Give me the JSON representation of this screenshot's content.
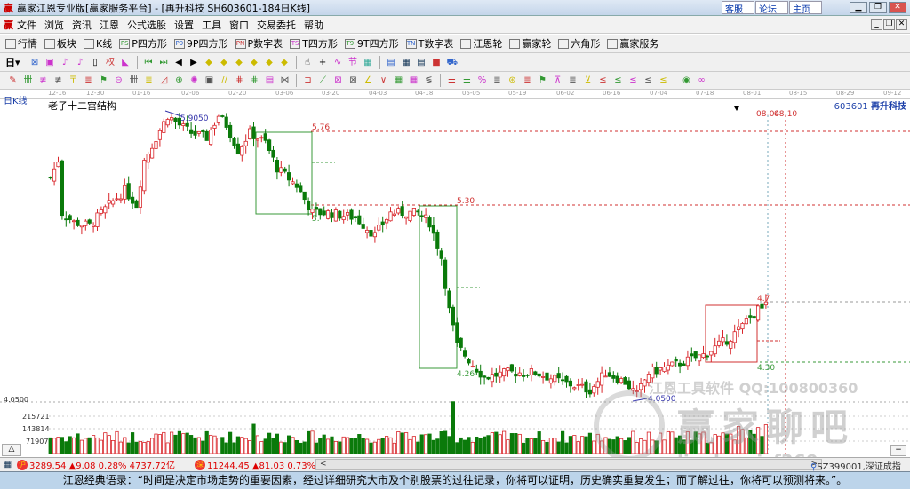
{
  "window": {
    "logo": "赢",
    "title": "赢家江恩专业版[赢家服务平台] - [再升科技  SH603601-184日K线]",
    "links": [
      "客服",
      "论坛",
      "主页"
    ]
  },
  "menu": [
    "文件",
    "浏览",
    "资讯",
    "江恩",
    "公式选股",
    "设置",
    "工具",
    "窗口",
    "交易委托",
    "帮助"
  ],
  "toolbar1": [
    {
      "icon": "quote-table-icon",
      "label": "行情"
    },
    {
      "icon": "sector-icon",
      "label": "板块"
    },
    {
      "icon": "kline-icon",
      "label": "K线"
    },
    {
      "icon": "p-square-icon",
      "badge": "PS",
      "label": "P四方形"
    },
    {
      "icon": "9p-square-icon",
      "badge": "P9",
      "label": "9P四方形"
    },
    {
      "icon": "p-number-icon",
      "badge": "PN",
      "label": "P数字表"
    },
    {
      "icon": "t-square-icon",
      "badge": "TS",
      "label": "T四方形"
    },
    {
      "icon": "9t-square-icon",
      "badge": "T9",
      "label": "9T四方形"
    },
    {
      "icon": "t-number-icon",
      "badge": "TN",
      "label": "T数字表"
    },
    {
      "icon": "gann-wheel-icon",
      "label": "江恩轮"
    },
    {
      "icon": "winner-wheel-icon",
      "label": "赢家轮"
    },
    {
      "icon": "hexagon-icon",
      "label": "六角形"
    },
    {
      "icon": "dollar-icon",
      "label": "赢家服务"
    }
  ],
  "toolbar2_period": "日",
  "chart": {
    "period_label": "日K线",
    "title": "老子十二宫结构",
    "code": "603601",
    "name": "再升科技",
    "date_ticks": [
      "12-16",
      "12-30",
      "01-16",
      "02-06",
      "02-20",
      "03-06",
      "03-20",
      "04-03",
      "04-18",
      "05-05",
      "05-19",
      "06-02",
      "06-16",
      "07-04",
      "07-18",
      "08-01",
      "08-15",
      "08-29",
      "09-12"
    ],
    "price_labels": {
      "high": "5.9050",
      "low": "4.0500",
      "l576": "5.76",
      "l530": "5.30",
      "l426": "4.26",
      "l430": "4.30",
      "l5": "5.",
      "l47": "4.7",
      "d1": "08-04",
      "d2": "08-10"
    },
    "volume_ticks": [
      "4.0500",
      "215721",
      "143814",
      "71907"
    ],
    "colors": {
      "up": "#d9262b",
      "down": "#0a7a0a",
      "box_green": "#3a9a3a",
      "box_red": "#d03030"
    }
  },
  "chart_data": {
    "type": "candlestick",
    "bars": 184,
    "close_path": [
      [
        0,
        5.47
      ],
      [
        2,
        5.58
      ],
      [
        3,
        5.25
      ],
      [
        6,
        5.19
      ],
      [
        10,
        5.17
      ],
      [
        15,
        5.3
      ],
      [
        19,
        5.39
      ],
      [
        22,
        5.3
      ],
      [
        24,
        5.58
      ],
      [
        27,
        5.72
      ],
      [
        30,
        5.86
      ],
      [
        33,
        5.8
      ],
      [
        36,
        5.75
      ],
      [
        40,
        5.72
      ],
      [
        43,
        5.86
      ],
      [
        45,
        5.8
      ],
      [
        48,
        5.64
      ],
      [
        51,
        5.75
      ],
      [
        55,
        5.69
      ],
      [
        58,
        5.53
      ],
      [
        63,
        5.42
      ],
      [
        67,
        5.25
      ],
      [
        71,
        5.25
      ],
      [
        78,
        5.22
      ],
      [
        83,
        5.11
      ],
      [
        87,
        5.25
      ],
      [
        94,
        5.25
      ],
      [
        97,
        5.19
      ],
      [
        100,
        4.97
      ],
      [
        102,
        4.64
      ],
      [
        104,
        4.42
      ],
      [
        108,
        4.3
      ],
      [
        111,
        4.22
      ],
      [
        117,
        4.25
      ],
      [
        124,
        4.25
      ],
      [
        131,
        4.19
      ],
      [
        138,
        4.14
      ],
      [
        142,
        4.25
      ],
      [
        147,
        4.19
      ],
      [
        150,
        4.11
      ],
      [
        153,
        4.25
      ],
      [
        160,
        4.3
      ],
      [
        167,
        4.36
      ],
      [
        174,
        4.47
      ],
      [
        181,
        4.64
      ],
      [
        184,
        4.72
      ]
    ],
    "high": 5.905,
    "low": 4.05
  },
  "status": {
    "sh_icon": "沪",
    "sh": "3289.54 ▲9.08 0.28% 4737.72亿",
    "sz_icon": "深",
    "sz": "11244.45 ▲81.03 0.73% 5225.70亿",
    "scroll_left": "<",
    "scroll_right": ">",
    "index": "SZ399001,深证成指",
    "collapse": "△",
    "minus": "−"
  },
  "quote": "江恩经典语录：“时间是决定市场走势的重要因素，经过详细研究大市及个别股票的过往记录，你将可以证明，历史确实重复发生；而了解过往，你将可以预测将来。”。",
  "watermark": {
    "line1": "江恩工具软件  QQ:100800360",
    "line2": "赢家聊吧",
    "line3": "liaoba.yjcf360.com"
  }
}
